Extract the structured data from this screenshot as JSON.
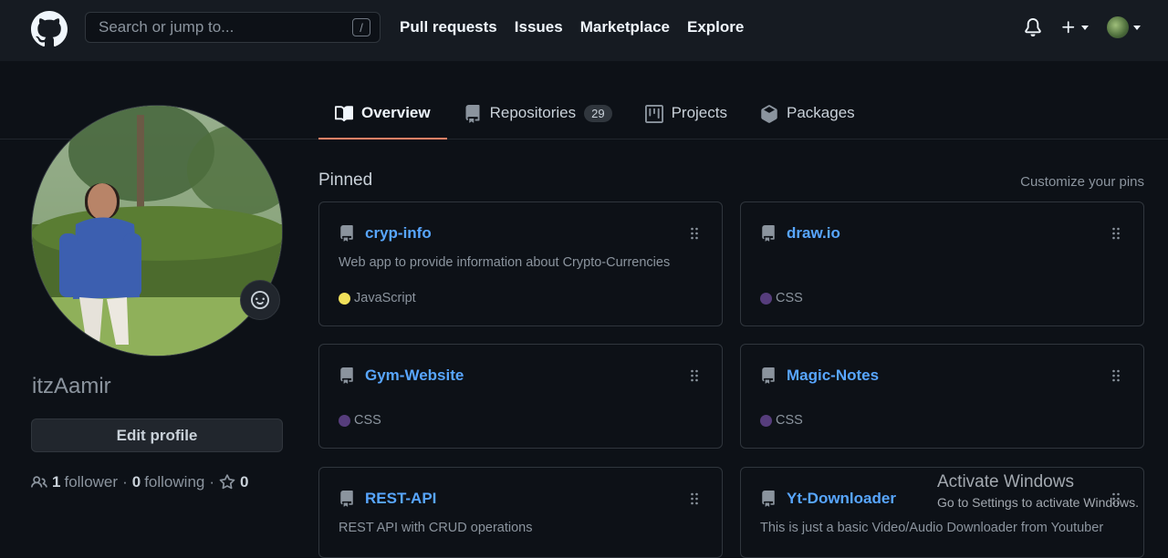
{
  "header": {
    "search_placeholder": "Search or jump to...",
    "slash_key": "/",
    "nav": [
      "Pull requests",
      "Issues",
      "Marketplace",
      "Explore"
    ]
  },
  "tabs": [
    {
      "label": "Overview",
      "active": true
    },
    {
      "label": "Repositories",
      "count": "29"
    },
    {
      "label": "Projects"
    },
    {
      "label": "Packages"
    }
  ],
  "profile": {
    "username": "itzAamir",
    "edit_button": "Edit profile",
    "followers_count": "1",
    "followers_label": "follower",
    "following_count": "0",
    "following_label": "following",
    "stars_count": "0"
  },
  "pinned": {
    "title": "Pinned",
    "customize_link": "Customize your pins",
    "repos": [
      {
        "name": "cryp-info",
        "description": "Web app to provide information about Crypto-Currencies",
        "language": "JavaScript",
        "language_color": "#f1e05a"
      },
      {
        "name": "draw.io",
        "description": "",
        "language": "CSS",
        "language_color": "#563d7c"
      },
      {
        "name": "Gym-Website",
        "description": "",
        "language": "CSS",
        "language_color": "#563d7c"
      },
      {
        "name": "Magic-Notes",
        "description": "",
        "language": "CSS",
        "language_color": "#563d7c"
      },
      {
        "name": "REST-API",
        "description": "REST API with CRUD operations",
        "language": "",
        "language_color": ""
      },
      {
        "name": "Yt-Downloader",
        "description": "This is just a basic Video/Audio Downloader from Youtuber",
        "language": "",
        "language_color": ""
      }
    ]
  },
  "watermark": {
    "title": "Activate Windows",
    "subtitle": "Go to Settings to activate Windows."
  },
  "colors": {
    "background": "#0d1117",
    "header_bg": "#161b22",
    "link": "#58a6ff",
    "tab_underline": "#f78166"
  }
}
